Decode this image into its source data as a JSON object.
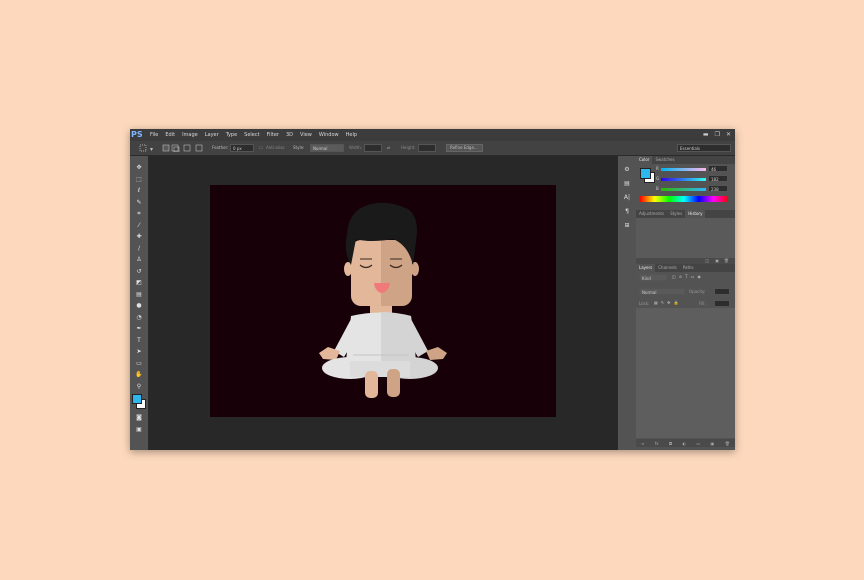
{
  "app": {
    "logo": "PS"
  },
  "menu": [
    "File",
    "Edit",
    "Image",
    "Layer",
    "Type",
    "Select",
    "Filter",
    "3D",
    "View",
    "Window",
    "Help"
  ],
  "window_controls": [
    "▬",
    "❐",
    "✕"
  ],
  "options": {
    "feather_label": "Feather:",
    "feather_value": "0 px",
    "antialias_label": "Anti-alias",
    "style_label": "Style:",
    "style_value": "Normal",
    "width_label": "Width:",
    "height_label": "Height:",
    "refine_edge": "Refine Edge...",
    "workspace": "Essentials"
  },
  "color_panel": {
    "tabs": [
      "Color",
      "Swatches"
    ],
    "sliders": [
      {
        "label": "R",
        "value": "46"
      },
      {
        "label": "G",
        "value": "182"
      },
      {
        "label": "B",
        "value": "238"
      }
    ],
    "foreground": "#2eb6ee",
    "background": "#ffffff"
  },
  "adjust_panel": {
    "tabs": [
      "Adjustments",
      "Styles",
      "History"
    ]
  },
  "layers_panel": {
    "tabs": [
      "Layers",
      "Channels",
      "Paths"
    ],
    "kind": "Kind",
    "blend": "Normal",
    "opacity_label": "Opacity:",
    "lock_label": "Lock:",
    "fill_label": "Fill:"
  },
  "colors": {
    "document_bg": "#170008",
    "accent": "#2eb6ee"
  }
}
